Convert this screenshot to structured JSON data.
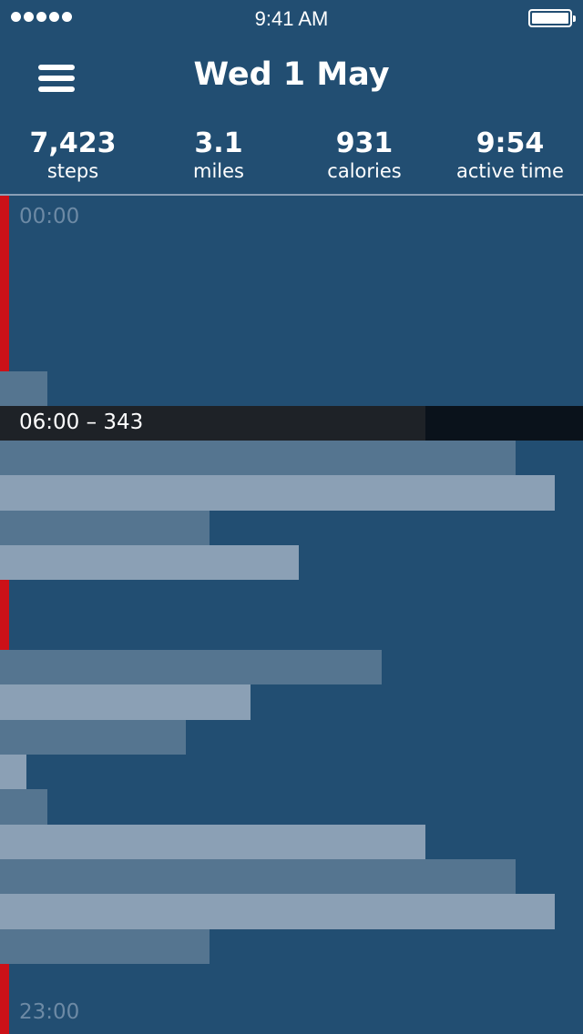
{
  "status_bar": {
    "time": "9:41 AM",
    "signal_icon": "signal-dots-icon",
    "battery_icon": "battery-icon",
    "battery_level": 1.0
  },
  "header": {
    "menu_icon": "hamburger-menu-icon",
    "title": "Wed 1 May"
  },
  "stats": [
    {
      "value": "7,423",
      "label": "steps"
    },
    {
      "value": "3.1",
      "label": "miles"
    },
    {
      "value": "931",
      "label": "calories"
    },
    {
      "value": "9:54",
      "label": "active time"
    }
  ],
  "timeline": {
    "start_label": "00:00",
    "end_label": "23:00",
    "selected_label": "06:00 – 343",
    "colors": {
      "background": "#224e72",
      "bar_dark": "#557590",
      "bar_light": "#8ba0b5",
      "inactive_marker": "#cc1118",
      "selection": "#1e2227"
    }
  }
}
